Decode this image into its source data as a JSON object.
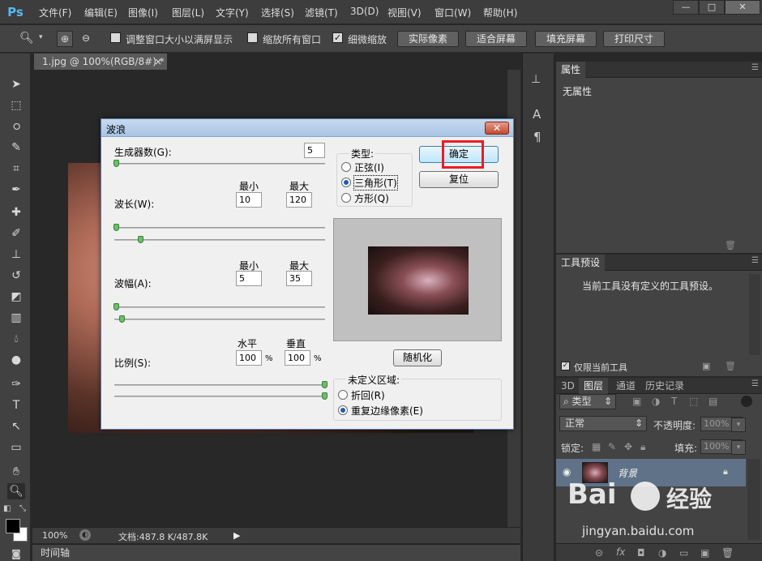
{
  "app": {
    "logo": "Ps"
  },
  "menu": [
    "文件(F)",
    "编辑(E)",
    "图像(I)",
    "图层(L)",
    "文字(Y)",
    "选择(S)",
    "滤镜(T)",
    "3D(D)",
    "视图(V)",
    "窗口(W)",
    "帮助(H)"
  ],
  "window_controls": {
    "minimize": "—",
    "restore": "□",
    "close": "✕"
  },
  "options_bar": {
    "resize_windows_label": "调整窗口大小以满屏显示",
    "zoom_all_label": "缩放所有窗口",
    "scrubby_zoom_label": "细微缩放",
    "actual_pixels": "实际像素",
    "fit_screen": "适合屏幕",
    "fill_screen": "填充屏幕",
    "print_size": "打印尺寸"
  },
  "document": {
    "tab_title": "1.jpg @ 100%(RGB/8#) *",
    "tab_close": "×",
    "zoom": "100%",
    "doc_size": "文档:487.8 K/487.8K",
    "timeline": "时间轴"
  },
  "dialog": {
    "title": "波浪",
    "close": "✕",
    "generators_label": "生成器数(G):",
    "generators_value": "5",
    "min_label": "最小",
    "max_label": "最大",
    "wavelength_label": "波长(W):",
    "wavelength_min": "10",
    "wavelength_max": "120",
    "amplitude_label": "波幅(A):",
    "amplitude_min": "5",
    "amplitude_max": "35",
    "scale_label": "比例(S):",
    "horizontal_label": "水平",
    "vertical_label": "垂直",
    "scale_h": "100",
    "scale_v": "100",
    "percent": "%",
    "type_label": "类型:",
    "type_sine": "正弦(I)",
    "type_triangle": "三角形(T)",
    "type_square": "方形(Q)",
    "ok": "确定",
    "reset": "复位",
    "randomize": "随机化",
    "undefined_label": "未定义区域:",
    "wrap_around": "折回(R)",
    "repeat_edge": "重复边缘像素(E)"
  },
  "panels": {
    "properties_tab": "属性",
    "properties_text": "无属性",
    "tool_presets_tab": "工具预设",
    "tool_presets_text": "当前工具没有定义的工具预设。",
    "current_tool_only": "仅限当前工具",
    "tab_3d": "3D",
    "tab_layers": "图层",
    "tab_channels": "通道",
    "tab_history": "历史记录",
    "filter_kind": "类型",
    "blend_mode": "正常",
    "opacity_label": "不透明度:",
    "opacity_value": "100%",
    "lock_label": "锁定:",
    "fill_label": "填充:",
    "fill_value": "100%",
    "layer_name": "背景"
  },
  "watermark": {
    "brand": "Bai",
    "brand2": "经验",
    "url": "jingyan.baidu.com"
  }
}
